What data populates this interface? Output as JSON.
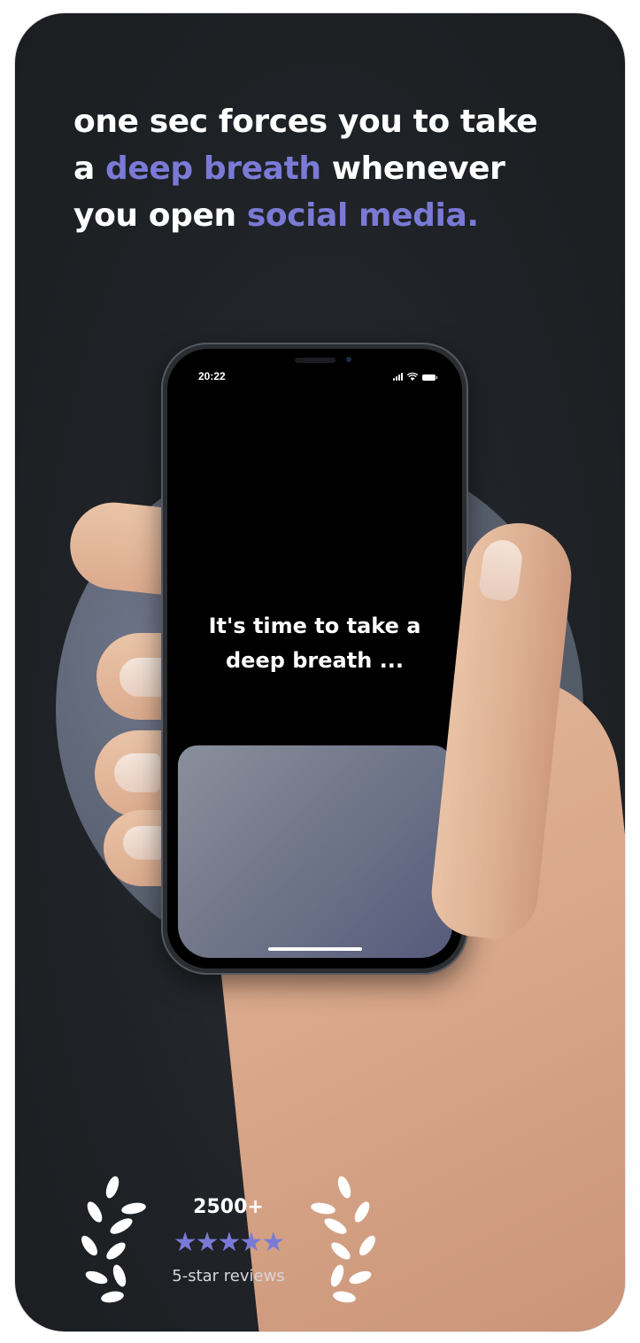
{
  "headline": {
    "line1": "one sec forces you to take",
    "line2_prefix": "a ",
    "line2_highlight": "deep breath",
    "line2_suffix": " whenever",
    "line3_prefix": "you open ",
    "line3_highlight": "social media."
  },
  "phone": {
    "status_time": "20:22",
    "message_line1": "It's time to take a",
    "message_line2": "deep breath ..."
  },
  "reviews": {
    "count": "2500+",
    "stars": "★★★★★",
    "label": "5-star reviews",
    "rating_value": 5,
    "rating_max": 5
  },
  "colors": {
    "accent": "#7a7ad6",
    "background": "#1f2226",
    "text": "#ffffff"
  },
  "icons": [
    "signal-icon",
    "wifi-icon",
    "battery-icon",
    "laurel-left-icon",
    "laurel-right-icon",
    "star-icon"
  ]
}
